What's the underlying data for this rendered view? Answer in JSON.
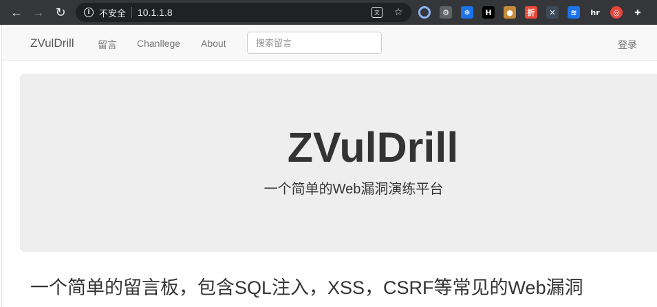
{
  "browser": {
    "security_label": "不安全",
    "url": "10.1.1.8",
    "extensions": [
      {
        "name": "circle-ext-icon",
        "label": "",
        "color": "#8ab4f8"
      },
      {
        "name": "gear-ext-icon",
        "label": "⚙",
        "color": "#5f6368"
      },
      {
        "name": "snowflake-ext-icon",
        "label": "❄",
        "color": "#1a73e8"
      },
      {
        "name": "h-ext-icon",
        "label": "H",
        "color": "#000000"
      },
      {
        "name": "cookie-ext-icon",
        "label": "●",
        "color": "#c58b3a"
      },
      {
        "name": "zhe-ext-icon",
        "label": "折",
        "color": "#e84a3a"
      },
      {
        "name": "x-ext-icon",
        "label": "✕",
        "color": "#3c4a5a"
      },
      {
        "name": "wave-ext-icon",
        "label": "≋",
        "color": "#1a73e8"
      },
      {
        "name": "hr-ext-icon",
        "label": "hr",
        "color": "#35363a"
      },
      {
        "name": "rainbow-ext-icon",
        "label": "◎",
        "color": "#e8453c"
      },
      {
        "name": "puzzle-ext-icon",
        "label": "✚",
        "color": "#35363a"
      }
    ]
  },
  "navbar": {
    "brand": "ZVulDrill",
    "links": [
      "留言",
      "Chanllege",
      "About"
    ],
    "search_placeholder": "搜索留言",
    "login": "登录"
  },
  "jumbotron": {
    "title": "ZVulDrill",
    "subtitle": "一个简单的Web漏洞演练平台"
  },
  "content": {
    "tagline": "一个简单的留言板，包含SQL注入，XSS，CSRF等常见的Web漏洞"
  }
}
